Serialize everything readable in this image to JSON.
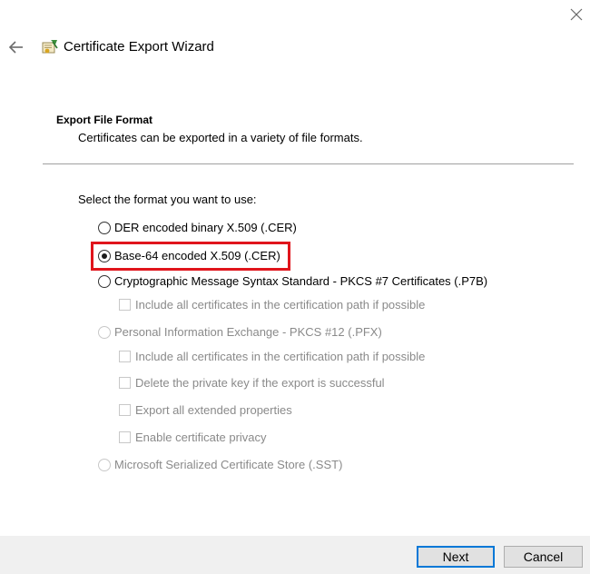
{
  "window": {
    "title": "Certificate Export Wizard"
  },
  "header": {
    "title": "Export File Format",
    "subtitle": "Certificates can be exported in a variety of file formats."
  },
  "prompt": "Select the format you want to use:",
  "options": [
    {
      "label": "DER encoded binary X.509 (.CER)",
      "type": "radio",
      "checked": false,
      "enabled": true
    },
    {
      "label": "Base-64 encoded X.509 (.CER)",
      "type": "radio",
      "checked": true,
      "enabled": true
    },
    {
      "label": "Cryptographic Message Syntax Standard - PKCS #7 Certificates (.P7B)",
      "type": "radio",
      "checked": false,
      "enabled": true
    },
    {
      "label": "Include all certificates in the certification path if possible",
      "type": "checkbox",
      "checked": false,
      "enabled": false
    },
    {
      "label": "Personal Information Exchange - PKCS #12 (.PFX)",
      "type": "radio",
      "checked": false,
      "enabled": false
    },
    {
      "label": "Include all certificates in the certification path if possible",
      "type": "checkbox",
      "checked": false,
      "enabled": false
    },
    {
      "label": "Delete the private key if the export is successful",
      "type": "checkbox",
      "checked": false,
      "enabled": false
    },
    {
      "label": "Export all extended properties",
      "type": "checkbox",
      "checked": false,
      "enabled": false
    },
    {
      "label": "Enable certificate privacy",
      "type": "checkbox",
      "checked": false,
      "enabled": false
    },
    {
      "label": "Microsoft Serialized Certificate Store (.SST)",
      "type": "radio",
      "checked": false,
      "enabled": false
    }
  ],
  "buttons": {
    "next": "Next",
    "cancel": "Cancel"
  },
  "colors": {
    "highlight": "#e0151c",
    "default_button_border": "#0078d7",
    "footer_bg": "#f0f0f0"
  }
}
